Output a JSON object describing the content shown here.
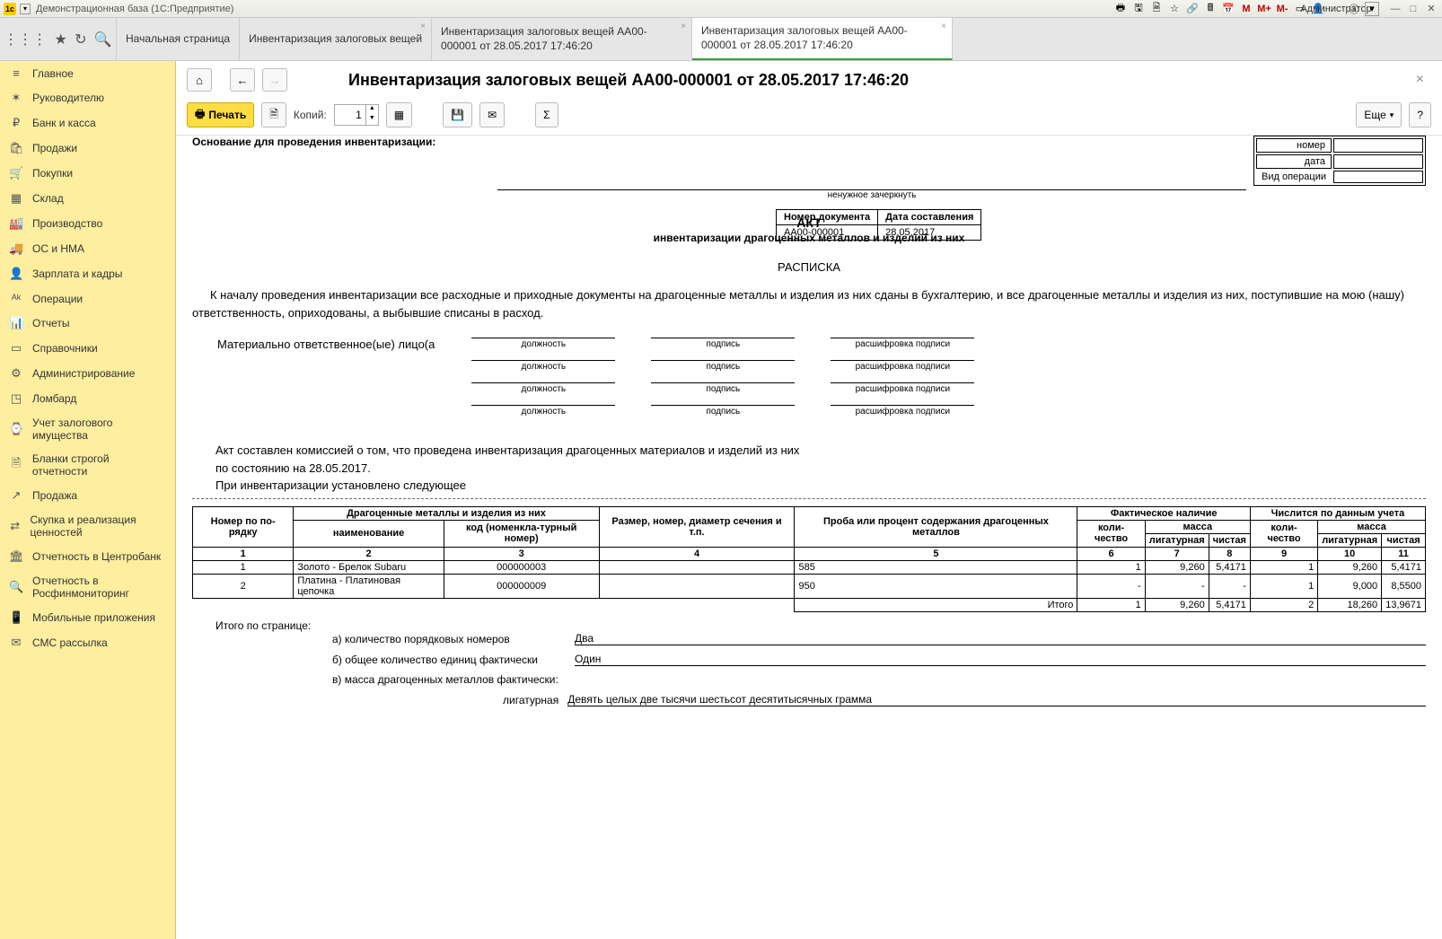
{
  "titlebar": {
    "app": "Демонстрационная база  (1С:Предприятие)",
    "m1": "M",
    "m2": "M+",
    "m3": "M-",
    "admin": "Администратор"
  },
  "tabs": {
    "t0": "Начальная страница",
    "t1": "Инвентаризация залоговых вещей",
    "t2": "Инвентаризация залоговых вещей АА00-000001 от 28.05.2017 17:46:20",
    "t3": "Инвентаризация залоговых вещей АА00-000001 от 28.05.2017 17:46:20"
  },
  "sidebar": {
    "items": [
      {
        "icon": "≡",
        "label": "Главное"
      },
      {
        "icon": "✶",
        "label": "Руководителю"
      },
      {
        "icon": "₽",
        "label": "Банк и касса"
      },
      {
        "icon": "🛍",
        "label": "Продажи"
      },
      {
        "icon": "🛒",
        "label": "Покупки"
      },
      {
        "icon": "▦",
        "label": "Склад"
      },
      {
        "icon": "🏭",
        "label": "Производство"
      },
      {
        "icon": "🚚",
        "label": "ОС и НМА"
      },
      {
        "icon": "👤",
        "label": "Зарплата и кадры"
      },
      {
        "icon": "ᴬᵏ",
        "label": "Операции"
      },
      {
        "icon": "📊",
        "label": "Отчеты"
      },
      {
        "icon": "▭",
        "label": "Справочники"
      },
      {
        "icon": "⚙",
        "label": "Администрирование"
      },
      {
        "icon": "◳",
        "label": "Ломбард"
      },
      {
        "icon": "⌚",
        "label": "Учет залогового имущества"
      },
      {
        "icon": "🗎",
        "label": "Бланки строгой отчетности"
      },
      {
        "icon": "↗",
        "label": "Продажа"
      },
      {
        "icon": "⇄",
        "label": "Скупка и реализация ценностей"
      },
      {
        "icon": "🏛",
        "label": "Отчетность в Центробанк"
      },
      {
        "icon": "🔍",
        "label": "Отчетность в Росфинмониторинг"
      },
      {
        "icon": "📱",
        "label": "Мобильные приложения"
      },
      {
        "icon": "✉",
        "label": "СМС рассылка"
      }
    ]
  },
  "header": {
    "title": "Инвентаризация залоговых вещей АА00-000001 от 28.05.2017 17:46:20"
  },
  "toolbar": {
    "print": "Печать",
    "copies_label": "Копий:",
    "copies_value": "1",
    "more": "Еще",
    "help": "?"
  },
  "doc": {
    "basis_label": "Основание для проведения инвентаризации:",
    "crossout": "ненужное зачеркнуть",
    "box": {
      "nomer": "номер",
      "data": "дата",
      "vidop": "Вид операции"
    },
    "docnum_h1": "Номер документа",
    "docnum_h2": "Дата составления",
    "docnum_v1": "АА00-000001",
    "docnum_v2": "28.05.2017",
    "act": "АКТ",
    "act_sub": "инвентаризации драгоценных металлов и изделий из них",
    "raspiska": "РАСПИСКА",
    "para": "К началу проведения инвентаризации все расходные и приходные документы на драгоценные металлы и изделия из них сданы в бухгалтерию, и все драгоценные металлы и изделия из них, поступившие на мою (нашу) ответственность, оприходованы, а выбывшие списаны в расход.",
    "molabel": "Материально ответственное(ые) лицо(а",
    "sig": {
      "pos": "должность",
      "sign": "подпись",
      "dec": "расшифровка подписи"
    },
    "made1": "Акт составлен комиссией о том, что проведена инвентаризация драгоценных материалов и изделий из них",
    "made2": "по состоянию на 28.05.2017.",
    "made3": "При инвентаризации установлено следующее",
    "th": {
      "num": "Номер по по-рядку",
      "dm": "Драгоценные металлы и изделия из них",
      "name": "наименование",
      "code": "код (номенкла-турный номер)",
      "size": "Размер, номер, диаметр сечения и т.п.",
      "proba": "Проба или процент содержания драгоценных металлов",
      "fact": "Фактическое наличие",
      "uchet": "Числится по данным учета",
      "qty": "коли-чество",
      "mass": "масса",
      "lig": "лигатурная",
      "chist": "чистая"
    },
    "colnums": [
      "1",
      "2",
      "3",
      "4",
      "5",
      "6",
      "7",
      "8",
      "9",
      "10",
      "11"
    ],
    "rows": [
      {
        "n": "1",
        "name": "Золото - Брелок Subaru",
        "code": "000000003",
        "size": "",
        "proba": "585",
        "qty": "1",
        "lig": "9,260",
        "chist": "5,4171",
        "uqty": "1",
        "ulig": "9,260",
        "uchist": "5,4171"
      },
      {
        "n": "2",
        "name": "Платина - Платиновая цепочка",
        "code": "000000009",
        "size": "",
        "proba": "950",
        "qty": "-",
        "lig": "-",
        "chist": "-",
        "uqty": "1",
        "ulig": "9,000",
        "uchist": "8,5500"
      }
    ],
    "itogo": "Итого",
    "itogo_row": {
      "qty": "1",
      "lig": "9,260",
      "chist": "5,4171",
      "uqty": "2",
      "ulig": "18,260",
      "uchist": "13,9671"
    },
    "pagetot_label": "Итого по странице:",
    "tot_a": "а) количество порядковых номеров",
    "tot_a_v": "Два",
    "tot_b": "б) общее количество единиц фактически",
    "tot_b_v": "Один",
    "tot_c": "в) масса драгоценных металлов фактически:",
    "tot_lig": "лигатурная",
    "tot_lig_v": "Девять целых две тысячи шестьсот десятитысячных грамма"
  }
}
